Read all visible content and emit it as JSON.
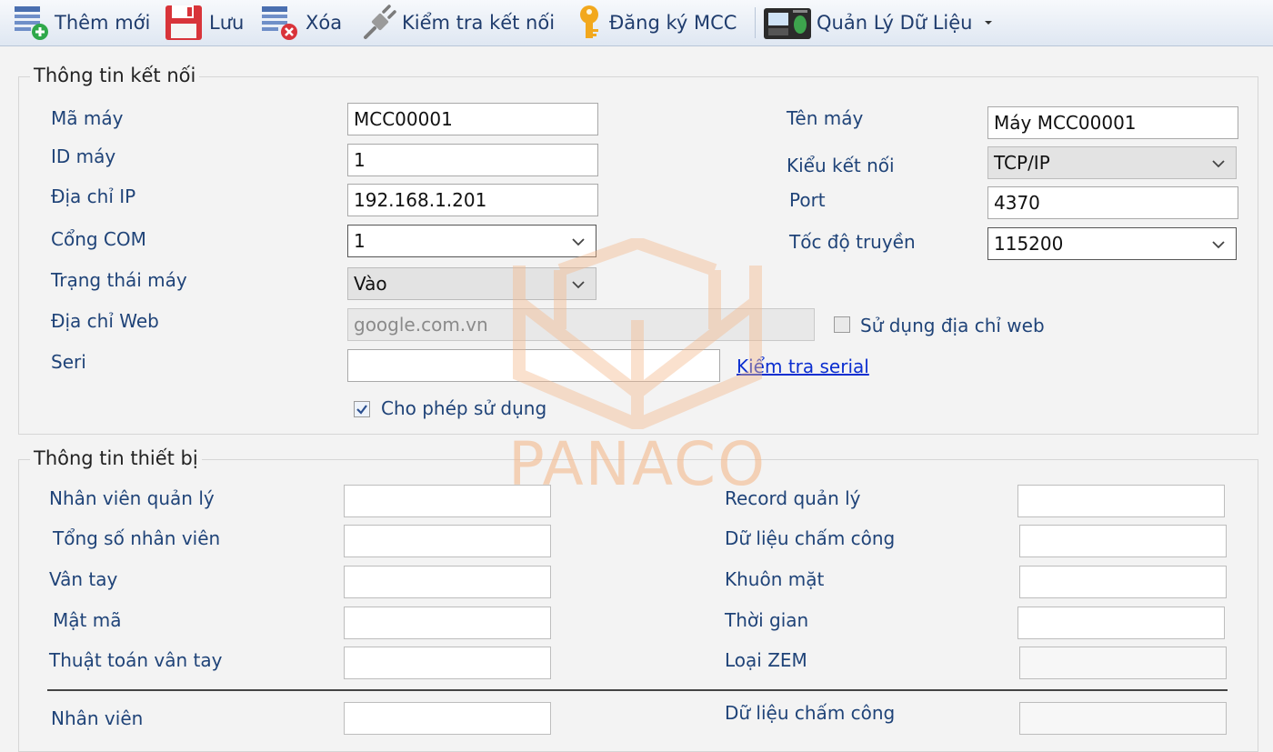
{
  "toolbar": {
    "add_label": "Thêm mới",
    "save_label": "Lưu",
    "delete_label": "Xóa",
    "test_connection_label": "Kiểm tra kết nối",
    "register_label": "Đăng ký MCC",
    "data_manage_label": "Quản Lý Dữ Liệu"
  },
  "connection": {
    "title": "Thông tin kết nối",
    "machine_code": {
      "label": "Mã máy",
      "value": "MCC00001"
    },
    "machine_id": {
      "label": "ID máy",
      "value": "1"
    },
    "ip_address": {
      "label": "Địa chỉ IP",
      "value": "192.168.1.201"
    },
    "com_port": {
      "label": "Cổng COM",
      "value": "1"
    },
    "machine_status": {
      "label": "Trạng thái máy",
      "value": "Vào"
    },
    "web_address": {
      "label": "Địa chỉ Web",
      "value": "google.com.vn"
    },
    "serial": {
      "label": "Seri",
      "value": ""
    },
    "machine_name": {
      "label": "Tên máy",
      "value": "Máy MCC00001"
    },
    "connection_type": {
      "label": "Kiểu kết nối",
      "value": "TCP/IP"
    },
    "port": {
      "label": "Port",
      "value": "4370"
    },
    "baud_rate": {
      "label": "Tốc độ truyền",
      "value": "115200"
    },
    "use_web_label": "Sử dụng địa chỉ web",
    "use_web_checked": false,
    "check_serial_label": "Kiểm tra serial",
    "allow_use_label": "Cho phép sử dụng",
    "allow_use_checked": true
  },
  "device": {
    "title": "Thông tin thiết bị",
    "left": [
      "Nhân viên quản lý",
      "Tổng số nhân viên",
      "Vân tay",
      "Mật mã",
      "Thuật toán vân tay"
    ],
    "right": [
      "Record quản lý",
      "Dữ liệu chấm công",
      "Khuôn mặt",
      "Thời gian",
      "Loại ZEM"
    ],
    "bottom_left": "Nhân viên",
    "bottom_right": "Dữ liệu chấm công"
  },
  "watermark": {
    "text": "PANACO",
    "color": "#f4b98d"
  },
  "colors": {
    "label": "#1f4378",
    "link": "#0b2ed0",
    "toolbar_bg": "#dfe7f2"
  }
}
